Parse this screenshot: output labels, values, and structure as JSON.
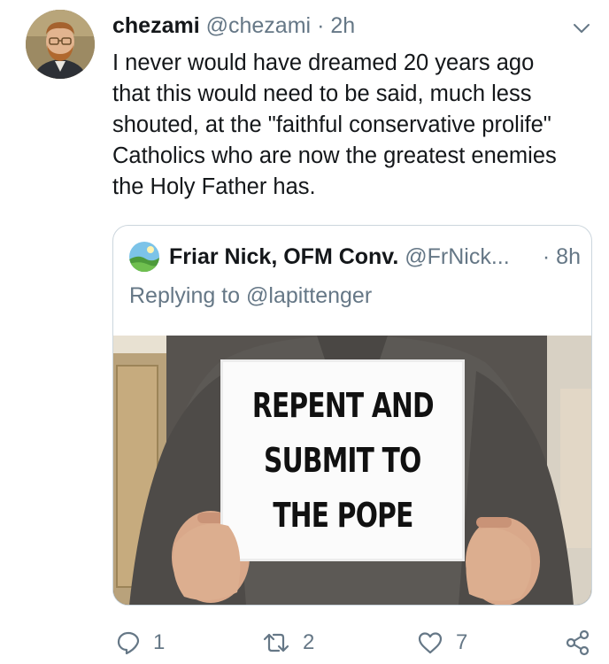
{
  "tweet": {
    "display_name": "chezami",
    "handle": "@chezami",
    "separator": "·",
    "time": "2h",
    "text": "I never would have dreamed 20 years ago\nthat this would need to be said, much less\nshouted, at the \"faithful conservative prolife\"\nCatholics who are now the greatest enemies\nthe Holy Father has."
  },
  "quoted": {
    "display_name": "Friar Nick, OFM Conv.",
    "handle": "@FrNick...",
    "time": "· 8h",
    "replying_to": "Replying to @lapittenger",
    "image_sign_lines": [
      "REPENT AND",
      "SUBMIT TO",
      "THE POPE"
    ]
  },
  "actions": {
    "reply_count": "1",
    "retweet_count": "2",
    "like_count": "7"
  },
  "icons": [
    "caret-down-icon",
    "reply-icon",
    "retweet-icon",
    "like-icon",
    "share-icon"
  ],
  "colors": {
    "secondary_text": "#657786",
    "border": "#ccd6dd",
    "text": "#14171a"
  }
}
